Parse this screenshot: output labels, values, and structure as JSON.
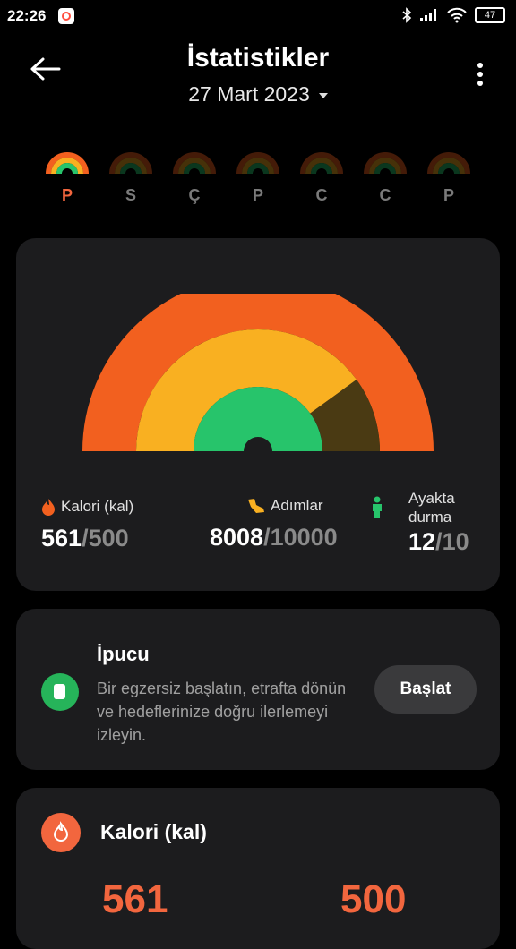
{
  "status": {
    "time": "22:26",
    "battery": "47"
  },
  "header": {
    "title": "İstatistikler",
    "date": "27 Mart 2023"
  },
  "week": [
    {
      "label": "P",
      "active": true
    },
    {
      "label": "S",
      "active": false
    },
    {
      "label": "Ç",
      "active": false
    },
    {
      "label": "P",
      "active": false
    },
    {
      "label": "C",
      "active": false
    },
    {
      "label": "C",
      "active": false
    },
    {
      "label": "P",
      "active": false
    }
  ],
  "activity": {
    "colors": {
      "calories": "#f2601f",
      "steps": "#f9b021",
      "standing": "#27c46b",
      "steps_remaining": "#4a3a13"
    },
    "calories": {
      "label": "Kalori (kal)",
      "value": "561",
      "goal": "500",
      "progress": 1.0
    },
    "steps": {
      "label": "Adımlar",
      "value": "8008",
      "goal": "10000",
      "progress": 0.8
    },
    "standing": {
      "label": "Ayakta durma",
      "value": "12",
      "goal": "10",
      "progress": 1.0
    }
  },
  "tip": {
    "title": "İpucu",
    "text": "Bir egzersiz başlatın, etrafta dönün ve hedeflerinize doğru ilerlemeyi izleyin.",
    "button": "Başlat"
  },
  "calorie_card": {
    "title": "Kalori (kal)",
    "value": "561",
    "goal": "500"
  }
}
